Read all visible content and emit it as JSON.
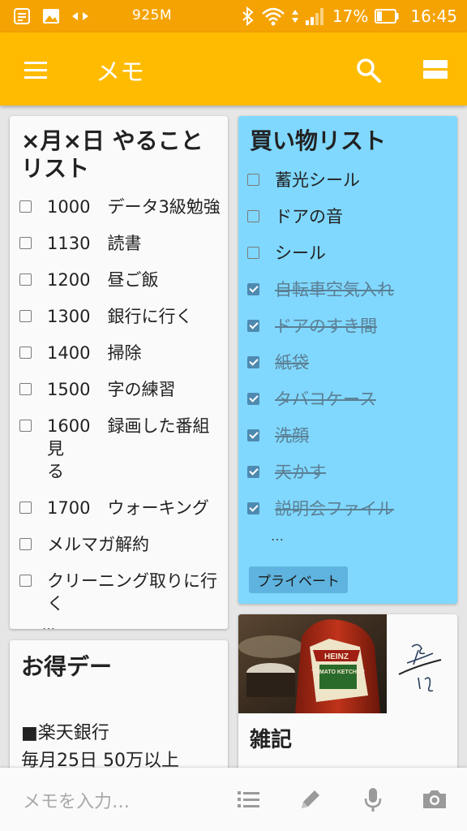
{
  "status_bar": {
    "network_speed": "925M",
    "battery_percent": "17%",
    "time": "16:45"
  },
  "app_bar": {
    "title": "メモ"
  },
  "notes": {
    "todo": {
      "title": "×月×日 やること\nリスト",
      "items": [
        {
          "text": "1000　データ3級勉強",
          "checked": false
        },
        {
          "text": "1130　読書",
          "checked": false
        },
        {
          "text": "1200　昼ご飯",
          "checked": false
        },
        {
          "text": "1300　銀行に行く",
          "checked": false
        },
        {
          "text": "1400　掃除",
          "checked": false
        },
        {
          "text": "1500　字の練習",
          "checked": false
        },
        {
          "text": "1600　録画した番組見\nる",
          "checked": false
        },
        {
          "text": "1700　ウォーキング",
          "checked": false
        },
        {
          "text": "メルマガ解約",
          "checked": false
        },
        {
          "text": "クリーニング取りに行\nく",
          "checked": false
        }
      ],
      "more": "…"
    },
    "shopping": {
      "title": "買い物リスト",
      "background": "#80D8FF",
      "items": [
        {
          "text": "蓄光シール",
          "checked": false
        },
        {
          "text": "ドアの音",
          "checked": false
        },
        {
          "text": "シール",
          "checked": false
        },
        {
          "text": "自転車空気入れ",
          "checked": true
        },
        {
          "text": "ドアのすき間",
          "checked": true
        },
        {
          "text": "紙袋",
          "checked": true
        },
        {
          "text": "タバコケース",
          "checked": true
        },
        {
          "text": "洗顔",
          "checked": true
        },
        {
          "text": "天かす",
          "checked": true
        },
        {
          "text": "説明会ファイル",
          "checked": true
        }
      ],
      "more": "…",
      "label": "プライベート"
    },
    "deals": {
      "title": "お得デー",
      "body_line1": "■楽天銀行",
      "body_line2": "毎月25日 50万以上"
    },
    "misc": {
      "title": "雑記",
      "image_text_brand": "HEINZ",
      "image_text_product": "TOMATO KETCHUP"
    }
  },
  "bottom_bar": {
    "placeholder": "メモを入力…",
    "icons": [
      "list-icon",
      "pen-icon",
      "mic-icon",
      "camera-icon"
    ]
  },
  "colors": {
    "status_bar": "#F5A302",
    "app_bar": "#FFBB00",
    "shopping_card": "#80D8FF"
  }
}
